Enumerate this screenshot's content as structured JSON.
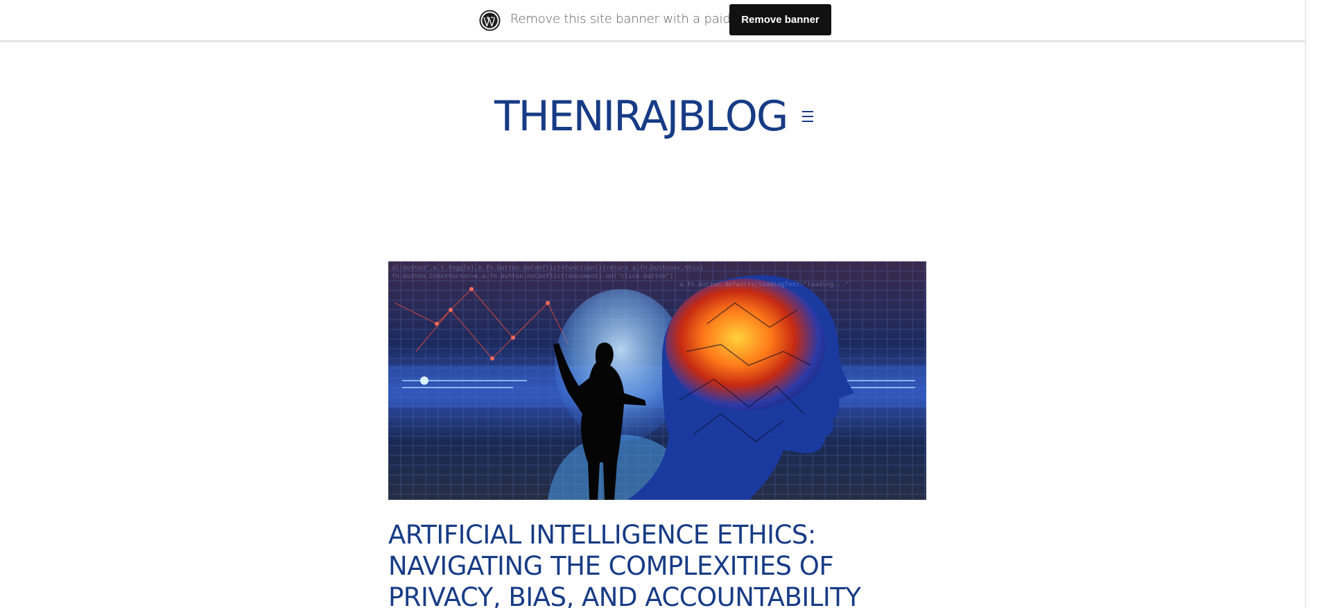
{
  "banner": {
    "logo_icon": "wordpress-logo-icon",
    "text": "Remove this site banner with a paid plan",
    "button_label": "Remove banner"
  },
  "header": {
    "site_title": "THENIRAJBLOG",
    "menu_icon": "hamburger-menu-icon"
  },
  "post": {
    "featured_image": "ai-head-brain-silhouette-image",
    "title": "ARTIFICIAL INTELLIGENCE ETHICS: NAVIGATING THE COMPLEXITIES OF PRIVACY, BIAS, AND ACCOUNTABILITY"
  },
  "colors": {
    "brand": "#173b85",
    "banner_button": "#111111"
  }
}
